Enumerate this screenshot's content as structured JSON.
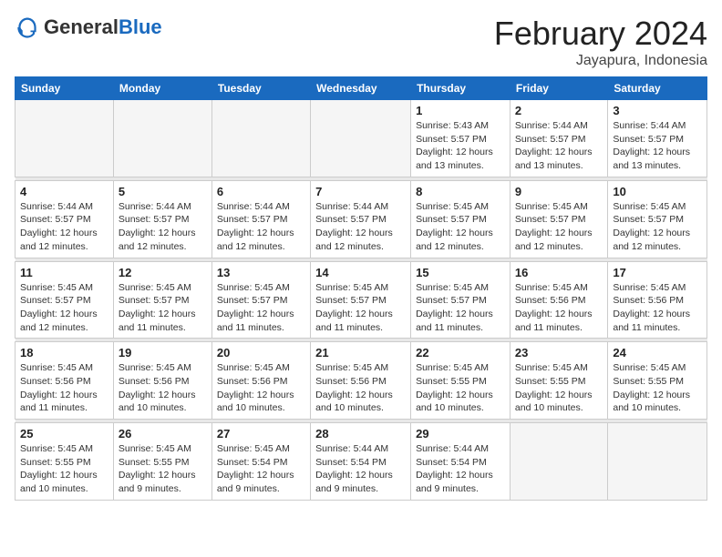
{
  "logo": {
    "general": "General",
    "blue": "Blue"
  },
  "header": {
    "month": "February 2024",
    "location": "Jayapura, Indonesia"
  },
  "weekdays": [
    "Sunday",
    "Monday",
    "Tuesday",
    "Wednesday",
    "Thursday",
    "Friday",
    "Saturday"
  ],
  "weeks": [
    [
      {
        "day": "",
        "info": ""
      },
      {
        "day": "",
        "info": ""
      },
      {
        "day": "",
        "info": ""
      },
      {
        "day": "",
        "info": ""
      },
      {
        "day": "1",
        "info": "Sunrise: 5:43 AM\nSunset: 5:57 PM\nDaylight: 12 hours\nand 13 minutes."
      },
      {
        "day": "2",
        "info": "Sunrise: 5:44 AM\nSunset: 5:57 PM\nDaylight: 12 hours\nand 13 minutes."
      },
      {
        "day": "3",
        "info": "Sunrise: 5:44 AM\nSunset: 5:57 PM\nDaylight: 12 hours\nand 13 minutes."
      }
    ],
    [
      {
        "day": "4",
        "info": "Sunrise: 5:44 AM\nSunset: 5:57 PM\nDaylight: 12 hours\nand 12 minutes."
      },
      {
        "day": "5",
        "info": "Sunrise: 5:44 AM\nSunset: 5:57 PM\nDaylight: 12 hours\nand 12 minutes."
      },
      {
        "day": "6",
        "info": "Sunrise: 5:44 AM\nSunset: 5:57 PM\nDaylight: 12 hours\nand 12 minutes."
      },
      {
        "day": "7",
        "info": "Sunrise: 5:44 AM\nSunset: 5:57 PM\nDaylight: 12 hours\nand 12 minutes."
      },
      {
        "day": "8",
        "info": "Sunrise: 5:45 AM\nSunset: 5:57 PM\nDaylight: 12 hours\nand 12 minutes."
      },
      {
        "day": "9",
        "info": "Sunrise: 5:45 AM\nSunset: 5:57 PM\nDaylight: 12 hours\nand 12 minutes."
      },
      {
        "day": "10",
        "info": "Sunrise: 5:45 AM\nSunset: 5:57 PM\nDaylight: 12 hours\nand 12 minutes."
      }
    ],
    [
      {
        "day": "11",
        "info": "Sunrise: 5:45 AM\nSunset: 5:57 PM\nDaylight: 12 hours\nand 12 minutes."
      },
      {
        "day": "12",
        "info": "Sunrise: 5:45 AM\nSunset: 5:57 PM\nDaylight: 12 hours\nand 11 minutes."
      },
      {
        "day": "13",
        "info": "Sunrise: 5:45 AM\nSunset: 5:57 PM\nDaylight: 12 hours\nand 11 minutes."
      },
      {
        "day": "14",
        "info": "Sunrise: 5:45 AM\nSunset: 5:57 PM\nDaylight: 12 hours\nand 11 minutes."
      },
      {
        "day": "15",
        "info": "Sunrise: 5:45 AM\nSunset: 5:57 PM\nDaylight: 12 hours\nand 11 minutes."
      },
      {
        "day": "16",
        "info": "Sunrise: 5:45 AM\nSunset: 5:56 PM\nDaylight: 12 hours\nand 11 minutes."
      },
      {
        "day": "17",
        "info": "Sunrise: 5:45 AM\nSunset: 5:56 PM\nDaylight: 12 hours\nand 11 minutes."
      }
    ],
    [
      {
        "day": "18",
        "info": "Sunrise: 5:45 AM\nSunset: 5:56 PM\nDaylight: 12 hours\nand 11 minutes."
      },
      {
        "day": "19",
        "info": "Sunrise: 5:45 AM\nSunset: 5:56 PM\nDaylight: 12 hours\nand 10 minutes."
      },
      {
        "day": "20",
        "info": "Sunrise: 5:45 AM\nSunset: 5:56 PM\nDaylight: 12 hours\nand 10 minutes."
      },
      {
        "day": "21",
        "info": "Sunrise: 5:45 AM\nSunset: 5:56 PM\nDaylight: 12 hours\nand 10 minutes."
      },
      {
        "day": "22",
        "info": "Sunrise: 5:45 AM\nSunset: 5:55 PM\nDaylight: 12 hours\nand 10 minutes."
      },
      {
        "day": "23",
        "info": "Sunrise: 5:45 AM\nSunset: 5:55 PM\nDaylight: 12 hours\nand 10 minutes."
      },
      {
        "day": "24",
        "info": "Sunrise: 5:45 AM\nSunset: 5:55 PM\nDaylight: 12 hours\nand 10 minutes."
      }
    ],
    [
      {
        "day": "25",
        "info": "Sunrise: 5:45 AM\nSunset: 5:55 PM\nDaylight: 12 hours\nand 10 minutes."
      },
      {
        "day": "26",
        "info": "Sunrise: 5:45 AM\nSunset: 5:55 PM\nDaylight: 12 hours\nand 9 minutes."
      },
      {
        "day": "27",
        "info": "Sunrise: 5:45 AM\nSunset: 5:54 PM\nDaylight: 12 hours\nand 9 minutes."
      },
      {
        "day": "28",
        "info": "Sunrise: 5:44 AM\nSunset: 5:54 PM\nDaylight: 12 hours\nand 9 minutes."
      },
      {
        "day": "29",
        "info": "Sunrise: 5:44 AM\nSunset: 5:54 PM\nDaylight: 12 hours\nand 9 minutes."
      },
      {
        "day": "",
        "info": ""
      },
      {
        "day": "",
        "info": ""
      }
    ]
  ]
}
